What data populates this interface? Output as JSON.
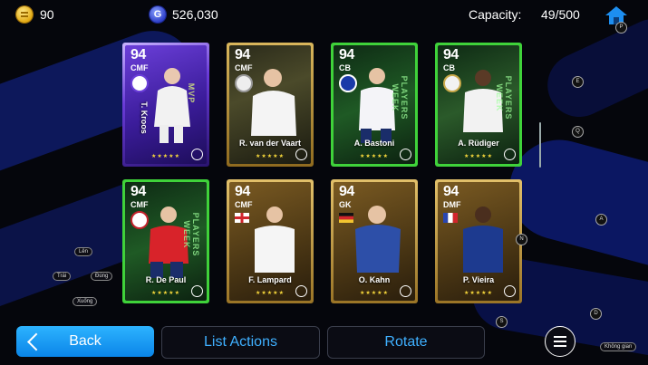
{
  "header": {
    "coins": "90",
    "gp_icon": "G",
    "gp": "526,030",
    "capacity_label": "Capacity:",
    "capacity_value": "49/500"
  },
  "hints": {
    "p": "P",
    "e": "E",
    "q": "Q",
    "a": "A",
    "n": "N",
    "d": "D",
    "s": "S",
    "len": "Lên",
    "trai": "Trái",
    "dung": "Đúng",
    "xuong": "Xuống",
    "khong_gian": "Không gian"
  },
  "cards": [
    {
      "rating": "94",
      "position": "CMF",
      "name": "T. Kroos",
      "stars": "★★★★★",
      "theme": "purple",
      "side_text": "MVP"
    },
    {
      "rating": "94",
      "position": "CMF",
      "name": "R. van der Vaart",
      "stars": "★★★★★",
      "theme": "gold-green"
    },
    {
      "rating": "94",
      "position": "CB",
      "name": "A. Bastoni",
      "stars": "★★★★★",
      "theme": "green",
      "side_text": "PLAYERS WEEK"
    },
    {
      "rating": "94",
      "position": "CB",
      "name": "A. Rüdiger",
      "stars": "★★★★★",
      "theme": "green",
      "side_text": "PLAYERS WEEK"
    },
    {
      "rating": "94",
      "position": "CMF",
      "name": "R. De Paul",
      "stars": "★★★★★",
      "theme": "green",
      "side_text": "PLAYERS WEEK"
    },
    {
      "rating": "94",
      "position": "CMF",
      "name": "F. Lampard",
      "stars": "★★★★★",
      "theme": "gold"
    },
    {
      "rating": "94",
      "position": "GK",
      "name": "O. Kahn",
      "stars": "★★★★★",
      "theme": "gold"
    },
    {
      "rating": "94",
      "position": "DMF",
      "name": "P. Vieira",
      "stars": "★★★★★",
      "theme": "gold"
    }
  ],
  "footer": {
    "back": "Back",
    "list_actions": "List Actions",
    "rotate": "Rotate"
  },
  "colors": {
    "accent": "#3fb0ff",
    "back_button": "#1a9cf5",
    "star": "#f7d83b",
    "green_card": "#3fd23a",
    "gold_card": "#c99a3a"
  }
}
